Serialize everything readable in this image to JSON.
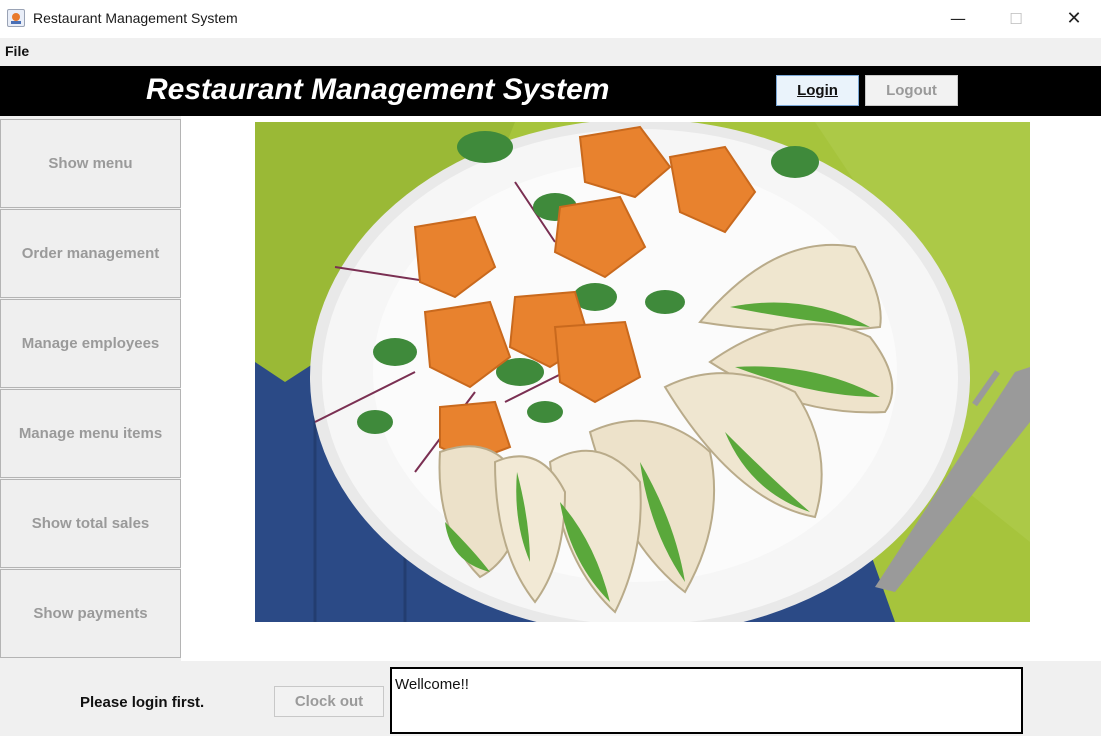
{
  "window": {
    "title": "Restaurant Management System",
    "controls": {
      "minimize": "—",
      "maximize": "☐",
      "close": "✕"
    }
  },
  "menubar": {
    "file": "File"
  },
  "header": {
    "title": "Restaurant Management System",
    "login_label": "Login",
    "logout_label": "Logout"
  },
  "sidebar": {
    "items": [
      {
        "label": "Show menu"
      },
      {
        "label": "Order management"
      },
      {
        "label": "Manage employees"
      },
      {
        "label": "Manage menu items"
      },
      {
        "label": "Show total sales"
      },
      {
        "label": "Show payments"
      }
    ]
  },
  "main": {
    "image": "plate-of-stuffed-chicken-and-roasted-squash-salad"
  },
  "footer": {
    "status": "Please login first.",
    "clock_out_label": "Clock out",
    "message": "Wellcome!!"
  },
  "colors": {
    "header_bg": "#000000",
    "disabled_text": "#9a9a9a",
    "login_accent": "#7aa7d6"
  }
}
